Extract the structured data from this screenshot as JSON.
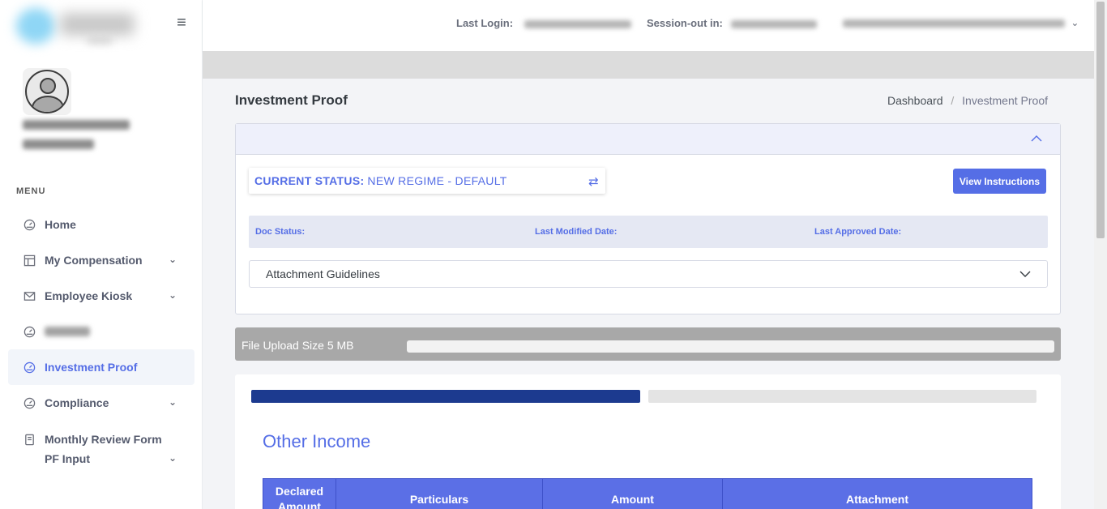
{
  "header": {
    "last_login_label": "Last Login:",
    "session_label": "Session-out in:",
    "user_dropdown_icon": "chevron-down-icon"
  },
  "sidebar": {
    "menu_title": "MENU",
    "items": [
      {
        "label": "Home",
        "icon": "dashboard-icon",
        "has_submenu": false
      },
      {
        "label": "My Compensation",
        "icon": "table-icon",
        "has_submenu": true
      },
      {
        "label": "Employee Kiosk",
        "icon": "mail-icon",
        "has_submenu": true
      },
      {
        "label": "",
        "icon": "dashboard-icon",
        "has_submenu": false
      },
      {
        "label": "Investment Proof",
        "icon": "dashboard-icon",
        "has_submenu": false,
        "active": true
      },
      {
        "label": "Compliance",
        "icon": "dashboard-icon",
        "has_submenu": true
      },
      {
        "label": "Monthly Review Form PF Input",
        "icon": "book-icon",
        "has_submenu": true
      }
    ]
  },
  "page": {
    "title": "Investment Proof",
    "breadcrumb": [
      "Dashboard",
      "Investment Proof"
    ]
  },
  "status_card": {
    "status_label": "CURRENT STATUS:",
    "status_value": "NEW REGIME - DEFAULT",
    "view_instructions": "View Instructions",
    "doc_status_label": "Doc Status:",
    "last_modified_label": "Last Modified Date:",
    "last_approved_label": "Last Approved Date:",
    "attachment_guidelines": "Attachment Guidelines"
  },
  "upload": {
    "label": "File Upload Size 5 MB"
  },
  "stepper": {
    "steps_total": 2,
    "current_step": 1
  },
  "section": {
    "title": "Other Income",
    "table_headers": [
      "Declared Amount",
      "Particulars",
      "Amount",
      "Attachment"
    ]
  },
  "colors": {
    "accent": "#556ee6",
    "stepper_done": "#1c3a8f",
    "table_header": "#5b6fe6"
  }
}
